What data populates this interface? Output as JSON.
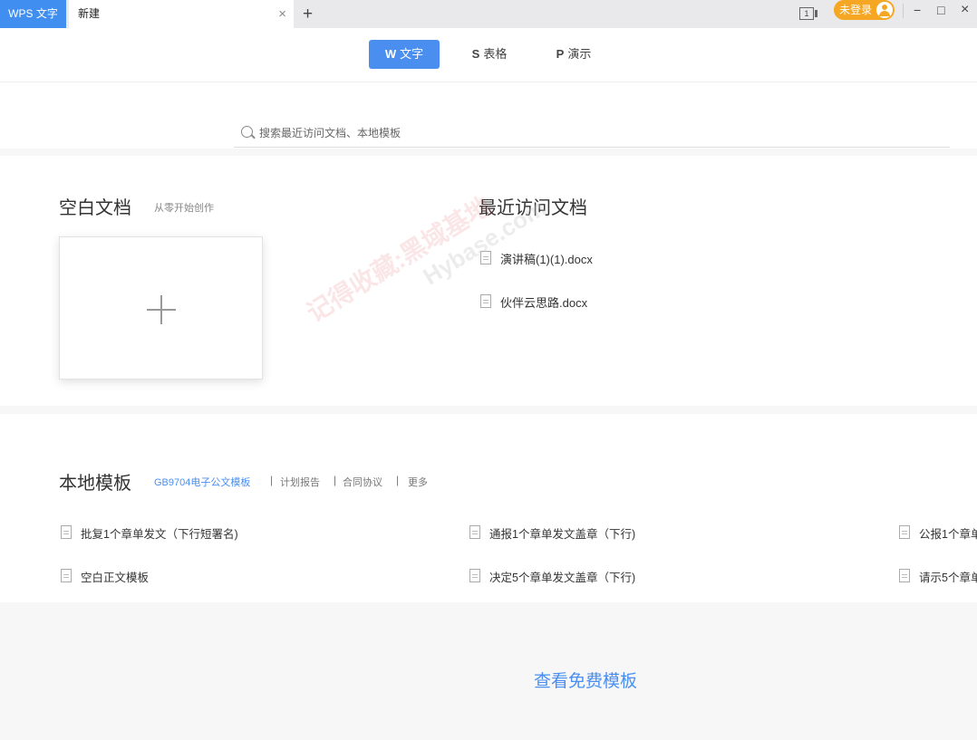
{
  "titlebar": {
    "app_tab": "WPS 文字",
    "doc_tab": "新建",
    "close_glyph": "×",
    "new_tab_glyph": "+",
    "page_count": "1",
    "login_label": "未登录",
    "minimize_glyph": "−",
    "maximize_glyph": "□",
    "close_window_glyph": "×"
  },
  "typebar": {
    "items": [
      {
        "glyph": "W",
        "label": "文字"
      },
      {
        "glyph": "S",
        "label": "表格"
      },
      {
        "glyph": "P",
        "label": "演示"
      }
    ]
  },
  "search": {
    "placeholder": "搜索最近访问文档、本地模板"
  },
  "blank": {
    "title": "空白文档",
    "subtitle": "从零开始创作"
  },
  "recent": {
    "title": "最近访问文档",
    "items": [
      "演讲稿(1)(1).docx",
      "伙伴云思路.docx"
    ]
  },
  "templates": {
    "title": "本地模板",
    "categories": [
      "GB9704电子公文模板",
      "计划报告",
      "合同协议",
      "更多"
    ],
    "items": [
      "批复1个章单发文（下行短署名)",
      "通报1个章单发文盖章（下行)",
      "公报1个章单",
      "空白正文模板",
      "决定5个章单发文盖章（下行)",
      "请示5个章单"
    ]
  },
  "footer": {
    "more_free": "查看免费模板"
  },
  "watermark": {
    "line1": "记得收藏:黑域基地",
    "line2": "Hybase.com"
  },
  "colors": {
    "accent": "#4a8ff0",
    "login": "#f5a623",
    "app_tab": "#3f8ef0"
  }
}
